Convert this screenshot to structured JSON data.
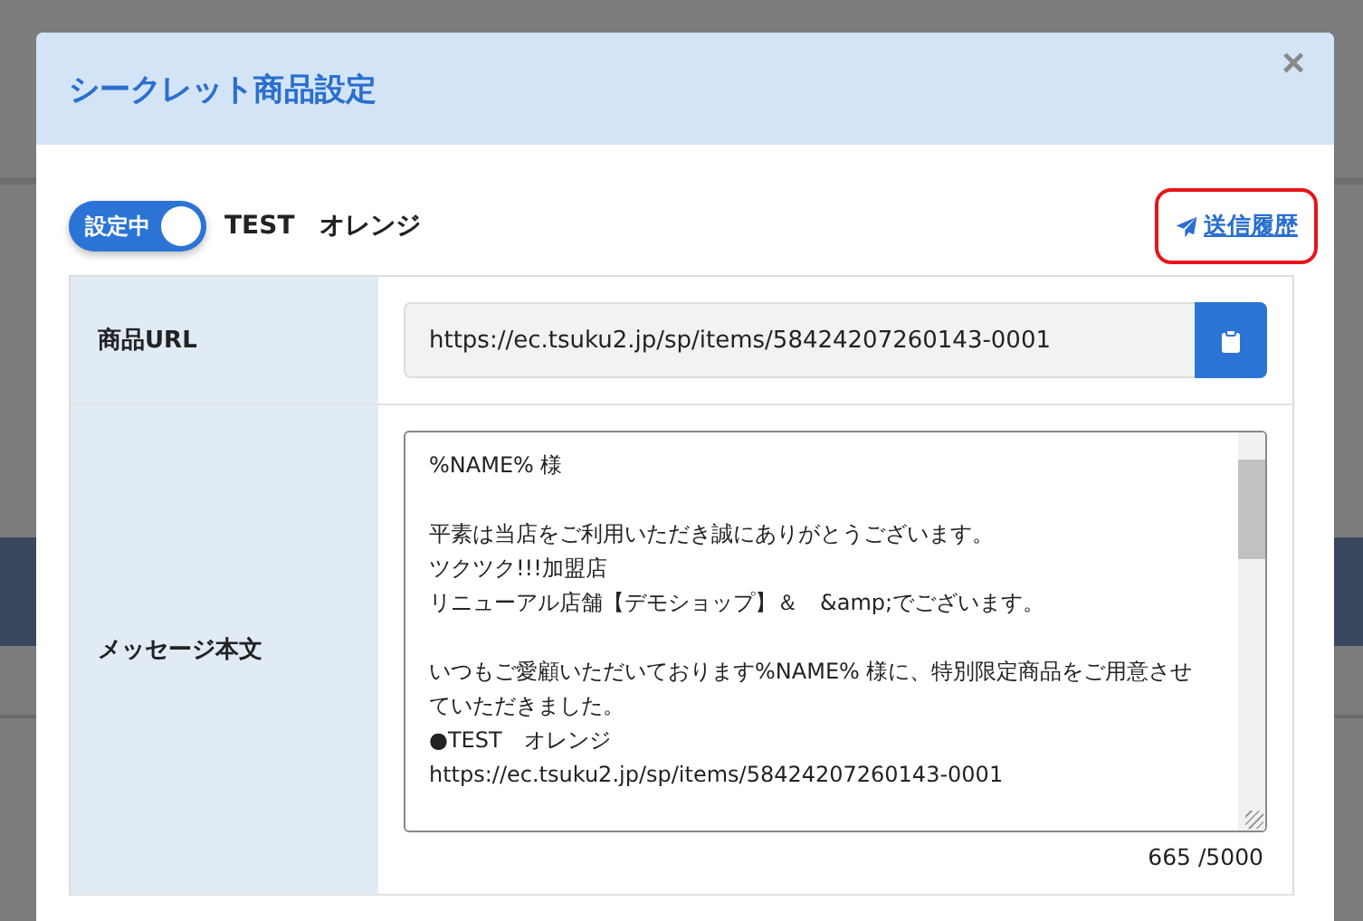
{
  "dialog": {
    "title": "シークレット商品設定",
    "close": "×"
  },
  "toggle": {
    "label": "設定中",
    "on": true
  },
  "product_name": "TEST　オレンジ",
  "history_link": {
    "label": "送信履歴",
    "highlighted": true
  },
  "form": {
    "rows": [
      {
        "kind": "url",
        "label": "商品URL",
        "value": "https://ec.tsuku2.jp/sp/items/58424207260143-0001"
      },
      {
        "kind": "message",
        "label": "メッセージ本文",
        "paragraphs": [
          [
            "%NAME% 様"
          ],
          [
            "平素は当店をご利用いただき誠にありがとうございます。",
            "ツクツク!!!加盟店",
            "リニューアル店舗【デモショップ】＆　&amp;でございます。"
          ],
          [
            "いつもご愛顧いただいております%NAME% 様に、特別限定商品をご用意させていただきました。",
            "●TEST　オレンジ",
            "https://ec.tsuku2.jp/sp/items/58424207260143-0001"
          ]
        ],
        "counter": "665 /5000"
      }
    ]
  }
}
